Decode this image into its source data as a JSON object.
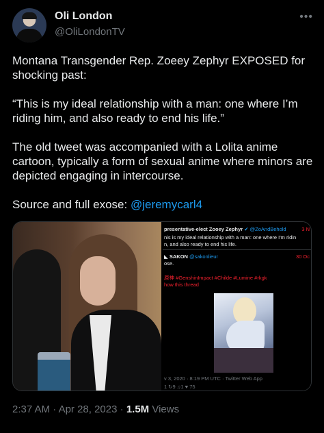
{
  "author": {
    "name": "Oli London",
    "handle": "@OliLondonTV"
  },
  "more_icon": "more-horizontal-icon",
  "tweet": {
    "p1": "Montana Transgender Rep. Zoeey Zephyr EXPOSED for shocking past:",
    "p2": "“This is my ideal relationship with a man: one where I’m riding him, and also ready to end his life.”",
    "p3": "The old tweet was accompanied with a Lolita anime cartoon, typically a form of sexual anime where minors are depicted engaging in intercourse.",
    "p4_prefix": "Source and full exose: ",
    "p4_link": "@jeremycarl4"
  },
  "embedded": {
    "row1_name": "presentative-elect Zooey Zephyr",
    "row1_handle": "@ZoAndBehold",
    "row1_date": "3 N",
    "line2": "nis is my ideal relationship with a man: one where I'm ridin",
    "line3": "n, and also ready to end his life.",
    "row2_name": "SAKON",
    "row2_handle": "@sakonlieur",
    "row2_date": "30 Oc",
    "line4": "ose.",
    "line5": "原神 #GenshinImpact #Childe #Lumine #rkgk",
    "line6": "how this thread",
    "footer": "v 3, 2020 · 8:19 PM UTC · Twitter Web App",
    "stats": "1  ↻9  ♫1  ♥ 75"
  },
  "meta": {
    "time": "2:37 AM",
    "sep1": " · ",
    "date": "Apr 28, 2023",
    "sep2": " · ",
    "views_count": "1.5M",
    "views_label": " Views"
  }
}
